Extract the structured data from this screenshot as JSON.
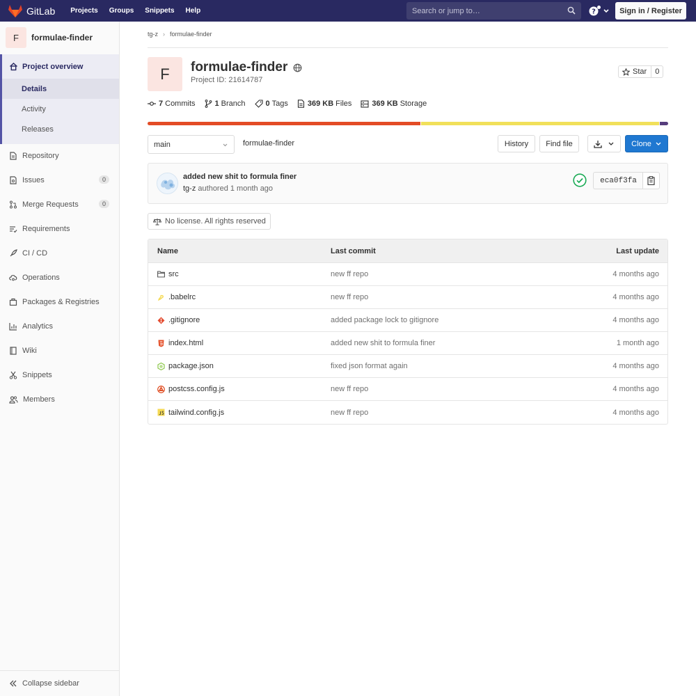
{
  "navbar": {
    "brand": "GitLab",
    "links": [
      "Projects",
      "Groups",
      "Snippets",
      "Help"
    ],
    "search_placeholder": "Search or jump to…",
    "signin_label": "Sign in / Register"
  },
  "sidebar": {
    "project_initial": "F",
    "project_name": "formulae-finder",
    "overview_label": "Project overview",
    "overview_subitems": [
      "Details",
      "Activity",
      "Releases"
    ],
    "items": [
      {
        "label": "Repository",
        "icon": "doc-icon"
      },
      {
        "label": "Issues",
        "icon": "issues-icon",
        "badge": "0"
      },
      {
        "label": "Merge Requests",
        "icon": "merge-request-icon",
        "badge": "0"
      },
      {
        "label": "Requirements",
        "icon": "requirements-icon"
      },
      {
        "label": "CI / CD",
        "icon": "rocket-icon"
      },
      {
        "label": "Operations",
        "icon": "cloud-gear-icon"
      },
      {
        "label": "Packages & Registries",
        "icon": "package-icon"
      },
      {
        "label": "Analytics",
        "icon": "chart-icon"
      },
      {
        "label": "Wiki",
        "icon": "book-icon"
      },
      {
        "label": "Snippets",
        "icon": "scissors-icon"
      },
      {
        "label": "Members",
        "icon": "users-icon"
      }
    ],
    "collapse_label": "Collapse sidebar"
  },
  "breadcrumb": [
    "tg-z",
    "formulae-finder"
  ],
  "project": {
    "initial": "F",
    "title": "formulae-finder",
    "id_text": "Project ID: 21614787",
    "star_label": "Star",
    "star_count": "0"
  },
  "stats": [
    {
      "value": "7",
      "label": "Commits",
      "icon": "commit-icon"
    },
    {
      "value": "1",
      "label": "Branch",
      "icon": "branch-icon"
    },
    {
      "value": "0",
      "label": "Tags",
      "icon": "tag-icon"
    },
    {
      "value": "369 KB",
      "label": "Files",
      "icon": "file-icon"
    },
    {
      "value": "369 KB",
      "label": "Storage",
      "icon": "storage-icon"
    }
  ],
  "language_bar": [
    {
      "color": "#e34c26",
      "percent": 52.5
    },
    {
      "color": "#f1e05a",
      "percent": 45.9
    },
    {
      "color": "#563d7c",
      "percent": 1.6
    }
  ],
  "toolbar": {
    "branch": "main",
    "path": "formulae-finder",
    "history_label": "History",
    "find_file_label": "Find file",
    "clone_label": "Clone"
  },
  "last_commit": {
    "title": "added new shit to formula finer",
    "author": "tg-z",
    "meta": "authored 1 month ago",
    "sha": "eca0f3fa",
    "pipeline_status": "passed"
  },
  "license_text": "No license. All rights reserved",
  "file_table": {
    "headers": [
      "Name",
      "Last commit",
      "Last update"
    ],
    "rows": [
      {
        "name": "src",
        "icon": "folder-icon",
        "commit": "new ff repo",
        "updated": "4 months ago"
      },
      {
        "name": ".babelrc",
        "icon": "babel-icon",
        "commit": "new ff repo",
        "updated": "4 months ago"
      },
      {
        "name": ".gitignore",
        "icon": "git-icon",
        "commit": "added package lock to gitignore",
        "updated": "4 months ago"
      },
      {
        "name": "index.html",
        "icon": "html-icon",
        "commit": "added new shit to formula finer",
        "updated": "1 month ago"
      },
      {
        "name": "package.json",
        "icon": "nodejs-icon",
        "commit": "fixed json format again",
        "updated": "4 months ago"
      },
      {
        "name": "postcss.config.js",
        "icon": "postcss-icon",
        "commit": "new ff repo",
        "updated": "4 months ago"
      },
      {
        "name": "tailwind.config.js",
        "icon": "js-icon",
        "commit": "new ff repo",
        "updated": "4 months ago"
      }
    ]
  }
}
